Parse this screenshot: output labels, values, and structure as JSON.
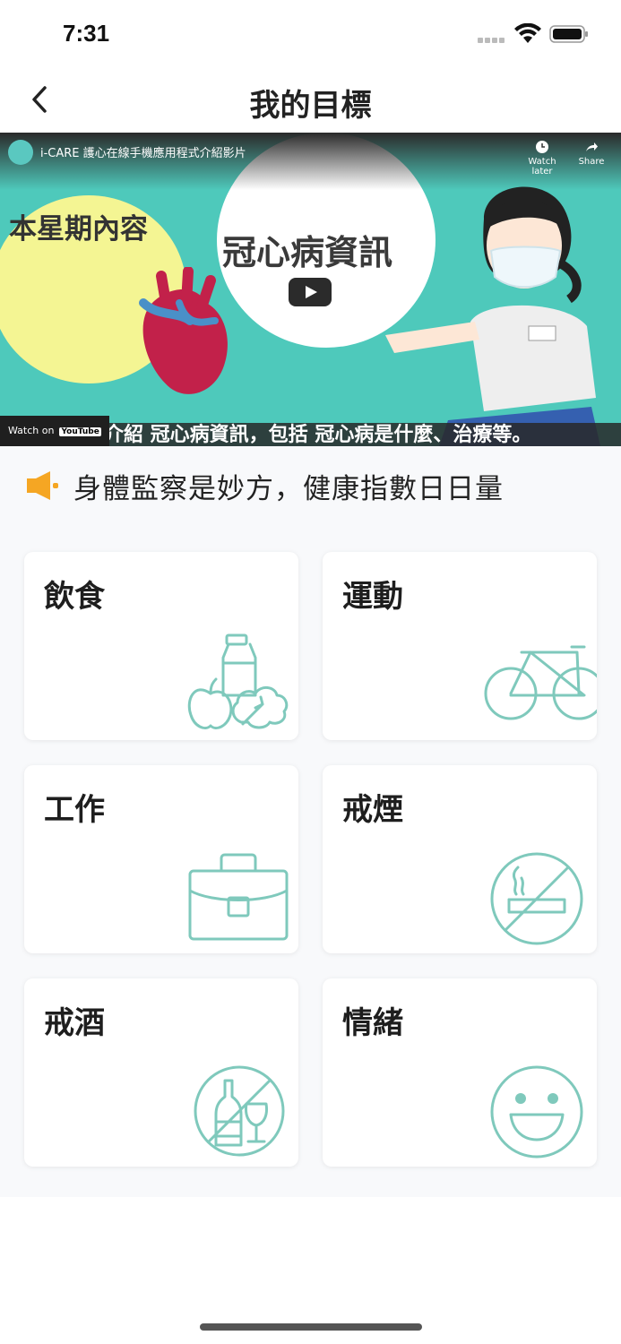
{
  "status_bar": {
    "time": "7:31"
  },
  "nav": {
    "title": "我的目標"
  },
  "video": {
    "channel_title": "i-CARE 護心在線手機應用程式介紹影片",
    "watch_later": "Watch later",
    "share": "Share",
    "left_bubble": "本星期內容",
    "center_bubble": "冠心病資訊",
    "subtitle": "我們會介紹 冠心病資訊，包括 冠心病是什麼、治療等。",
    "watch_on": "Watch on",
    "youtube": "YouTube"
  },
  "banner": {
    "text": "身體監察是妙方，健康指數日日量"
  },
  "categories": [
    {
      "label": "飲食",
      "icon": "food-icon"
    },
    {
      "label": "運動",
      "icon": "bicycle-icon"
    },
    {
      "label": "工作",
      "icon": "briefcase-icon"
    },
    {
      "label": "戒煙",
      "icon": "no-smoking-icon"
    },
    {
      "label": "戒酒",
      "icon": "no-alcohol-icon"
    },
    {
      "label": "情緒",
      "icon": "smiley-icon"
    }
  ],
  "colors": {
    "accent": "#7fc9bc",
    "speaker": "#f5a623",
    "background": "#f8f9fb"
  }
}
